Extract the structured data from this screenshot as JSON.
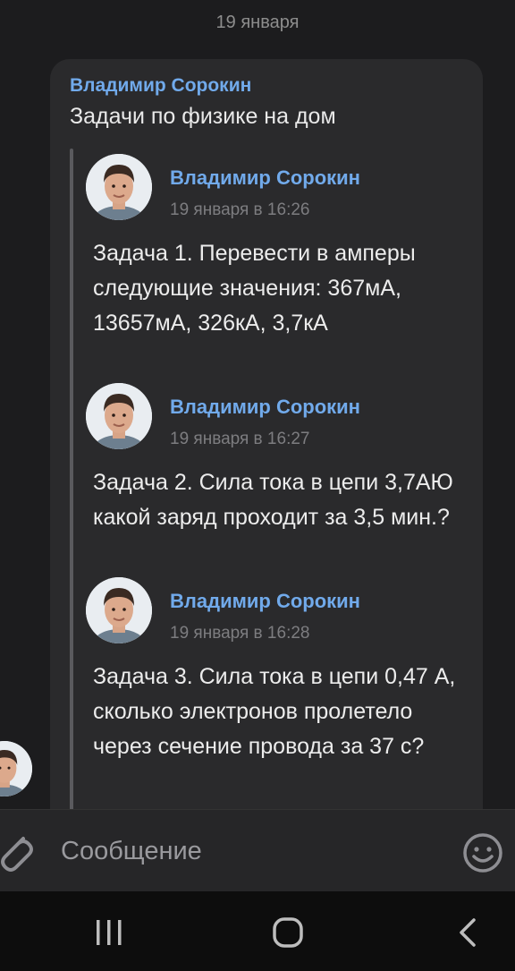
{
  "date_separator": "19 января",
  "message": {
    "sender": "Владимир Сорокин",
    "text": "Задачи по физике на дом",
    "forwarded": [
      {
        "name": "Владимир Сорокин",
        "time": "19 января в 16:26",
        "text": "Задача 1. Перевести в амперы следующие значения: 367мА, 13657мА, 326кА, 3,7кА"
      },
      {
        "name": "Владимир Сорокин",
        "time": "19 января в 16:27",
        "text": "Задача 2. Сила тока в цепи 3,7АЮ какой заряд проходит за 3,5 мин.?"
      },
      {
        "name": "Владимир Сорокин",
        "time": "19 января в 16:28",
        "text": "Задача 3. Сила тока в цепи 0,47 А, сколько электронов пролетело через сечение провода за 37 с?"
      }
    ]
  },
  "composer": {
    "placeholder": "Сообщение",
    "attach_icon": "paperclip-icon",
    "emoji_icon": "emoji-icon"
  },
  "navbar": {
    "recent_icon": "recent-apps-icon",
    "home_icon": "home-icon",
    "back_icon": "back-icon"
  },
  "colors": {
    "accent": "#71aaeb",
    "background": "#1c1c1e",
    "bubble": "#2a2a2c"
  }
}
